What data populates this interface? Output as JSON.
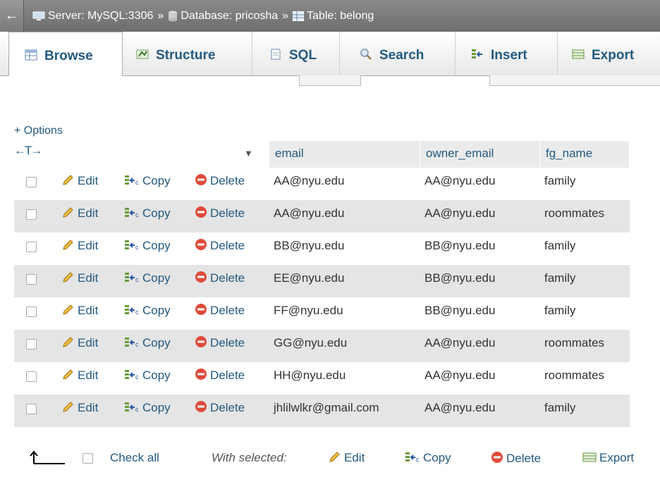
{
  "breadcrumb": {
    "back": "←",
    "server": "Server: MySQL:3306",
    "database": "Database: pricosha",
    "table": "Table: belong",
    "separator": "»"
  },
  "tabs": [
    {
      "label": "Browse",
      "icon": "browse-icon",
      "active": true
    },
    {
      "label": "Structure",
      "icon": "structure-icon"
    },
    {
      "label": "SQL",
      "icon": "sql-icon"
    },
    {
      "label": "Search",
      "icon": "search-icon"
    },
    {
      "label": "Insert",
      "icon": "insert-icon"
    },
    {
      "label": "Export",
      "icon": "export-icon"
    }
  ],
  "options_link": "+ Options",
  "table": {
    "resize_arrows": "←T→",
    "sort_indicator": "▼",
    "columns": [
      "email",
      "owner_email",
      "fg_name"
    ],
    "actions": {
      "edit": "Edit",
      "copy": "Copy",
      "delete": "Delete"
    },
    "rows": [
      {
        "email": "AA@nyu.edu",
        "owner_email": "AA@nyu.edu",
        "fg_name": "family"
      },
      {
        "email": "AA@nyu.edu",
        "owner_email": "AA@nyu.edu",
        "fg_name": "roommates"
      },
      {
        "email": "BB@nyu.edu",
        "owner_email": "BB@nyu.edu",
        "fg_name": "family"
      },
      {
        "email": "EE@nyu.edu",
        "owner_email": "BB@nyu.edu",
        "fg_name": "family"
      },
      {
        "email": "FF@nyu.edu",
        "owner_email": "BB@nyu.edu",
        "fg_name": "family"
      },
      {
        "email": "GG@nyu.edu",
        "owner_email": "AA@nyu.edu",
        "fg_name": "roommates"
      },
      {
        "email": "HH@nyu.edu",
        "owner_email": "AA@nyu.edu",
        "fg_name": "roommates"
      },
      {
        "email": "jhlilwlkr@gmail.com",
        "owner_email": "AA@nyu.edu",
        "fg_name": "family"
      }
    ]
  },
  "footer": {
    "check_all": "Check all",
    "with_selected": "With selected:",
    "edit": "Edit",
    "copy": "Copy",
    "delete": "Delete",
    "export": "Export"
  },
  "colors": {
    "link": "#235a81",
    "topbar": "#7a7a7a",
    "row_alt": "#e5e5e5",
    "header": "#ebebeb"
  }
}
